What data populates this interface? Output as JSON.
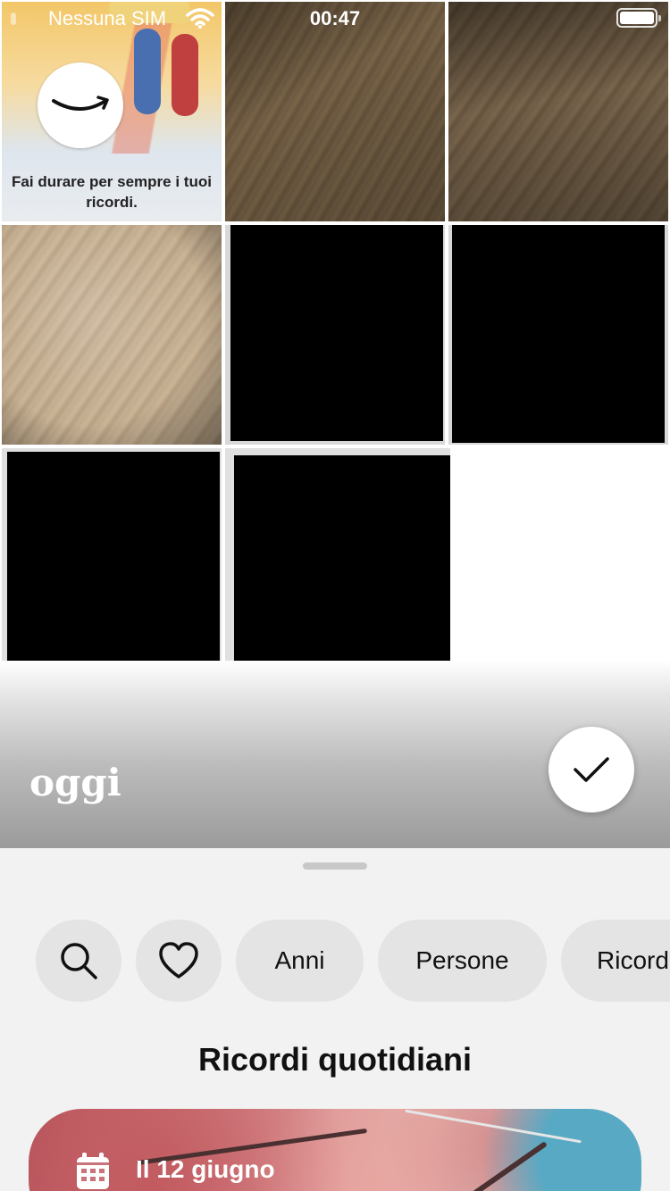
{
  "status_bar": {
    "carrier": "Nessuna SIM",
    "time": "00:47",
    "icons": [
      "wifi-icon",
      "battery-icon"
    ]
  },
  "grid": {
    "promo": {
      "logo_icon": "amazon-smile-logo",
      "text": "Fai durare per sempre i tuoi ricordi."
    },
    "tiles": [
      "promo",
      "wood-floor-photo",
      "wood-floor-photo",
      "wood-floor-photo",
      "black-photo",
      "black-photo",
      "black-photo",
      "black-photo"
    ]
  },
  "banner": {
    "date_label": "oggi",
    "select_icon": "checkmark-icon"
  },
  "sheet": {
    "chips": {
      "search_icon": "search-icon",
      "favorites_icon": "heart-icon",
      "years": "Anni",
      "people": "Persone",
      "memories_partial": "Ricord"
    },
    "section_title": "Ricordi quotidiani",
    "memory_card": {
      "icon": "calendar-icon",
      "date": "Il 12 giugno"
    }
  },
  "colors": {
    "sheet_background": "#f2f2f2",
    "chip_background": "#e4e4e4",
    "banner_text": "#ffffff"
  }
}
